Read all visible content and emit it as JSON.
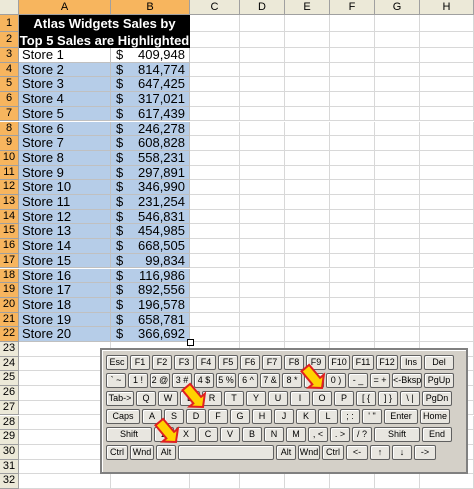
{
  "columns": [
    "A",
    "B",
    "C",
    "D",
    "E",
    "F",
    "G",
    "H"
  ],
  "row_numbers": [
    "1",
    "2",
    "3",
    "4",
    "5",
    "6",
    "7",
    "8",
    "9",
    "10",
    "11",
    "12",
    "13",
    "14",
    "15",
    "16",
    "17",
    "18",
    "19",
    "20",
    "21",
    "22",
    "23",
    "24",
    "25",
    "26",
    "27",
    "28",
    "29",
    "30",
    "31",
    "32"
  ],
  "title_line1": "Atlas Widgets Sales by Store",
  "title_line2": "Top 5 Sales are Highlighted",
  "currency_symbol": "$",
  "rows": [
    {
      "store": "Store 1",
      "value": "409,948",
      "highlighted": false
    },
    {
      "store": "Store 2",
      "value": "814,774",
      "highlighted": true
    },
    {
      "store": "Store 3",
      "value": "647,425",
      "highlighted": true
    },
    {
      "store": "Store 4",
      "value": "317,021",
      "highlighted": true
    },
    {
      "store": "Store 5",
      "value": "617,439",
      "highlighted": true
    },
    {
      "store": "Store 6",
      "value": "246,278",
      "highlighted": true
    },
    {
      "store": "Store 7",
      "value": "608,828",
      "highlighted": true
    },
    {
      "store": "Store 8",
      "value": "558,231",
      "highlighted": true
    },
    {
      "store": "Store 9",
      "value": "297,891",
      "highlighted": true
    },
    {
      "store": "Store 10",
      "value": "346,990",
      "highlighted": true
    },
    {
      "store": "Store 11",
      "value": "231,254",
      "highlighted": true
    },
    {
      "store": "Store 12",
      "value": "546,831",
      "highlighted": true
    },
    {
      "store": "Store 13",
      "value": "454,985",
      "highlighted": true
    },
    {
      "store": "Store 14",
      "value": "668,505",
      "highlighted": true
    },
    {
      "store": "Store 15",
      "value": "99,834",
      "highlighted": true
    },
    {
      "store": "Store 16",
      "value": "116,986",
      "highlighted": true
    },
    {
      "store": "Store 17",
      "value": "892,556",
      "highlighted": true
    },
    {
      "store": "Store 18",
      "value": "196,578",
      "highlighted": true
    },
    {
      "store": "Store 19",
      "value": "658,781",
      "highlighted": true
    },
    {
      "store": "Store 20",
      "value": "366,692",
      "highlighted": true
    }
  ],
  "colors": {
    "header_selected": "#f7b55e",
    "highlight": "#b6cde8",
    "title_bg": "#000000",
    "arrow_fill": "#ffd200",
    "arrow_stroke": "#e02020"
  },
  "keyboard": {
    "row1": [
      "Esc",
      "F1",
      "F2",
      "F3",
      "F4",
      "F5",
      "F6",
      "F7",
      "F8",
      "F9",
      "F10",
      "F11",
      "F12",
      "Ins",
      "Del"
    ],
    "row2": [
      "` ~",
      "1 !",
      "2 @",
      "3 #",
      "4 $",
      "5 %",
      "6 ^",
      "7 &",
      "8 *",
      "9 (",
      "0 )",
      "- _",
      "= +",
      "<-Bksp",
      "PgUp"
    ],
    "row3": [
      "Tab->",
      "Q",
      "W",
      "E",
      "R",
      "T",
      "Y",
      "U",
      "I",
      "O",
      "P",
      "[ {",
      "] }",
      "\\ |",
      "PgDn"
    ],
    "row4": [
      "Caps",
      "A",
      "S",
      "D",
      "F",
      "G",
      "H",
      "J",
      "K",
      "L",
      "; :",
      "' \"",
      "Enter",
      "Home"
    ],
    "row5": [
      "Shift",
      "Z",
      "X",
      "C",
      "V",
      "B",
      "N",
      "M",
      ", <",
      ". >",
      "/ ?",
      "Shift",
      "End"
    ],
    "row6": [
      "Ctrl",
      "Wnd",
      "Alt",
      "",
      "Alt",
      "Wnd",
      "Ctrl",
      "<-",
      "↑",
      "↓",
      "->"
    ]
  }
}
